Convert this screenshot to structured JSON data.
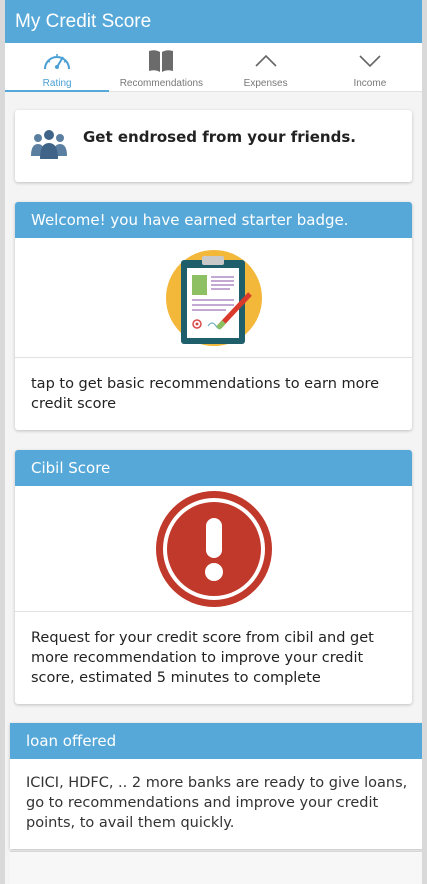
{
  "appbar": {
    "title": "My Credit Score"
  },
  "tabs": [
    {
      "label": "Rating",
      "icon": "gauge-icon",
      "active": true
    },
    {
      "label": "Recommendations",
      "icon": "book-icon"
    },
    {
      "label": "Expenses",
      "icon": "chevron-up-icon"
    },
    {
      "label": "Income",
      "icon": "chevron-down-icon"
    }
  ],
  "endorse": {
    "title": "Get endrosed from your friends.",
    "icon": "group-icon"
  },
  "badge_card": {
    "header": "Welcome! you have earned starter badge.",
    "icon": "clipboard-icon",
    "text": "tap to get basic recommendations to earn more credit score"
  },
  "cibil_card": {
    "header": "Cibil Score",
    "icon": "alert-icon",
    "text": "Request for your credit score from cibil and get more recommendation to improve your credit score, estimated 5 minutes to complete"
  },
  "loan_card": {
    "header": "loan offered",
    "text": "ICICI, HDFC, .. 2 more banks are ready to give loans, go to recommendations and improve your credit points, to avail them quickly."
  },
  "colors": {
    "accent": "#56a8d9",
    "alert": "#c0392b",
    "badge_bg": "#f3b73a"
  }
}
